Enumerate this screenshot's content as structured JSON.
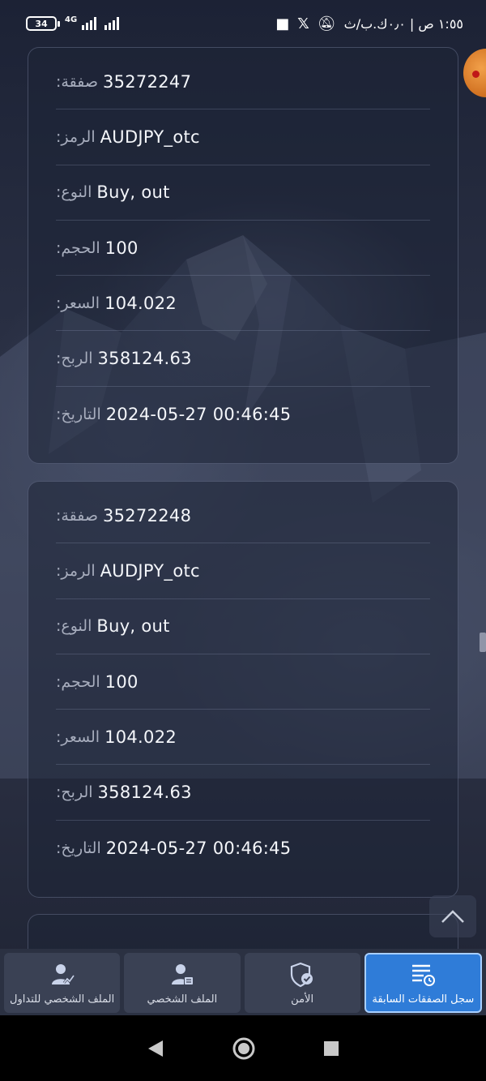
{
  "status_bar": {
    "battery": "34",
    "network": "4G",
    "time_text": "١:٥٥ ص | ٠٫٠ك.ب/ث"
  },
  "cards": [
    {
      "rows": [
        {
          "label": ":صفقة",
          "value": "35272247"
        },
        {
          "label": ":الرمز",
          "value": "AUDJPY_otc"
        },
        {
          "label": ":النوع",
          "value": "Buy, out"
        },
        {
          "label": ":الحجم",
          "value": "100"
        },
        {
          "label": ":السعر",
          "value": "104.022"
        },
        {
          "label": ":الربح",
          "value": "358124.63"
        },
        {
          "label": ":التاريخ",
          "value": "2024-05-27 00:46:45"
        }
      ]
    },
    {
      "rows": [
        {
          "label": ":صفقة",
          "value": "35272248"
        },
        {
          "label": ":الرمز",
          "value": "AUDJPY_otc"
        },
        {
          "label": ":النوع",
          "value": "Buy, out"
        },
        {
          "label": ":الحجم",
          "value": "100"
        },
        {
          "label": ":السعر",
          "value": "104.022"
        },
        {
          "label": ":الربح",
          "value": "358124.63"
        },
        {
          "label": ":التاريخ",
          "value": "2024-05-27 00:46:45"
        }
      ]
    }
  ],
  "bottom_nav": {
    "tabs": [
      {
        "label": "الملف الشخصي للتداول",
        "icon": "trading-profile-icon"
      },
      {
        "label": "الملف الشخصي",
        "icon": "profile-icon"
      },
      {
        "label": "الأمن",
        "icon": "security-shield-icon"
      },
      {
        "label": "سجل الصفقات السابقة",
        "icon": "trade-history-icon",
        "active": true
      }
    ]
  },
  "colors": {
    "accent": "#2f7cd8",
    "card_border": "#8c96b4",
    "background": "#1e2333"
  }
}
